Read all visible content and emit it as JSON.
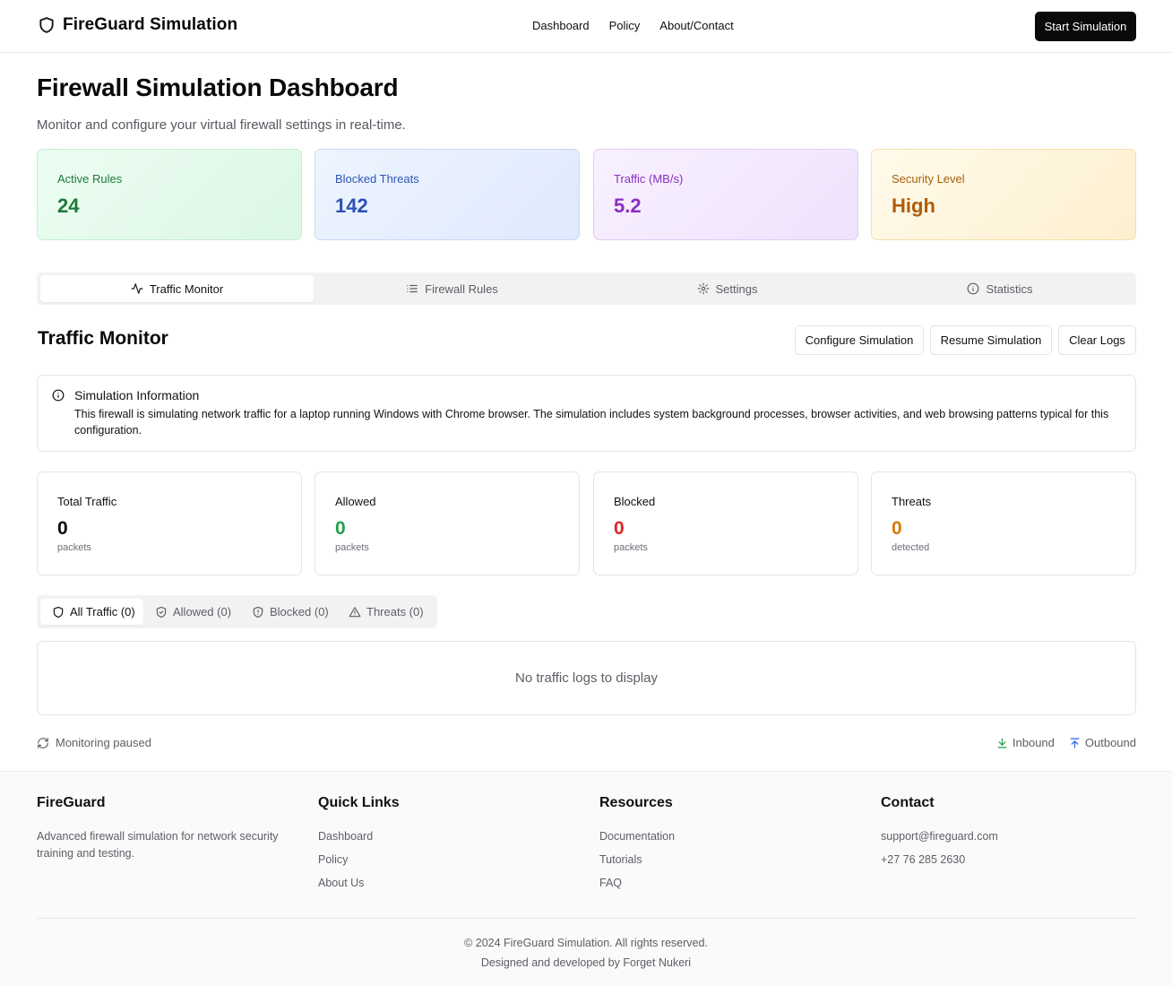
{
  "header": {
    "brand": "FireGuard Simulation",
    "nav": [
      "Dashboard",
      "Policy",
      "About/Contact"
    ],
    "start_button": "Start Simulation"
  },
  "page": {
    "title": "Firewall Simulation Dashboard",
    "subtitle": "Monitor and configure your virtual firewall settings in real-time."
  },
  "stats": [
    {
      "label": "Active Rules",
      "value": "24",
      "color": "#1e7a3a"
    },
    {
      "label": "Blocked Threats",
      "value": "142",
      "color": "#2a52b5"
    },
    {
      "label": "Traffic (MB/s)",
      "value": "5.2",
      "color": "#8b2cc2"
    },
    {
      "label": "Security Level",
      "value": "High",
      "color": "#b15a0a"
    }
  ],
  "tabs": [
    {
      "label": "Traffic Monitor",
      "icon": "activity-icon",
      "active": true
    },
    {
      "label": "Firewall Rules",
      "icon": "list-icon",
      "active": false
    },
    {
      "label": "Settings",
      "icon": "gear-icon",
      "active": false
    },
    {
      "label": "Statistics",
      "icon": "info-icon",
      "active": false
    }
  ],
  "section": {
    "title": "Traffic Monitor",
    "buttons": [
      "Configure Simulation",
      "Resume Simulation",
      "Clear Logs"
    ]
  },
  "info": {
    "title": "Simulation Information",
    "text": "This firewall is simulating network traffic for a laptop running Windows with Chrome browser. The simulation includes system background processes, browser activities, and web browsing patterns typical for this configuration."
  },
  "counters": [
    {
      "label": "Total Traffic",
      "value": "0",
      "unit": "packets",
      "color": "#0a0a0a"
    },
    {
      "label": "Allowed",
      "value": "0",
      "unit": "packets",
      "color": "#22a04b"
    },
    {
      "label": "Blocked",
      "value": "0",
      "unit": "packets",
      "color": "#dc2626"
    },
    {
      "label": "Threats",
      "value": "0",
      "unit": "detected",
      "color": "#d97706"
    }
  ],
  "filters": [
    {
      "label": "All Traffic (0)",
      "icon": "shield-icon",
      "active": true
    },
    {
      "label": "Allowed (0)",
      "icon": "shield-check-icon",
      "active": false
    },
    {
      "label": "Blocked (0)",
      "icon": "shield-alert-icon",
      "active": false
    },
    {
      "label": "Threats (0)",
      "icon": "warning-icon",
      "active": false
    }
  ],
  "logs": {
    "empty": "No traffic logs to display"
  },
  "status": {
    "text": "Monitoring paused"
  },
  "legend": {
    "inbound": "Inbound",
    "outbound": "Outbound",
    "inbound_color": "#22a04b",
    "outbound_color": "#2563eb"
  },
  "footer": {
    "about": {
      "title": "FireGuard",
      "text": "Advanced firewall simulation for network security training and testing."
    },
    "quick_links": {
      "title": "Quick Links",
      "items": [
        "Dashboard",
        "Policy",
        "About Us"
      ]
    },
    "resources": {
      "title": "Resources",
      "items": [
        "Documentation",
        "Tutorials",
        "FAQ"
      ]
    },
    "contact": {
      "title": "Contact",
      "items": [
        "support@fireguard.com",
        "+27 76 285 2630"
      ]
    },
    "copyright": "© 2024 FireGuard Simulation. All rights reserved.",
    "credit": "Designed and developed by Forget Nukeri"
  }
}
